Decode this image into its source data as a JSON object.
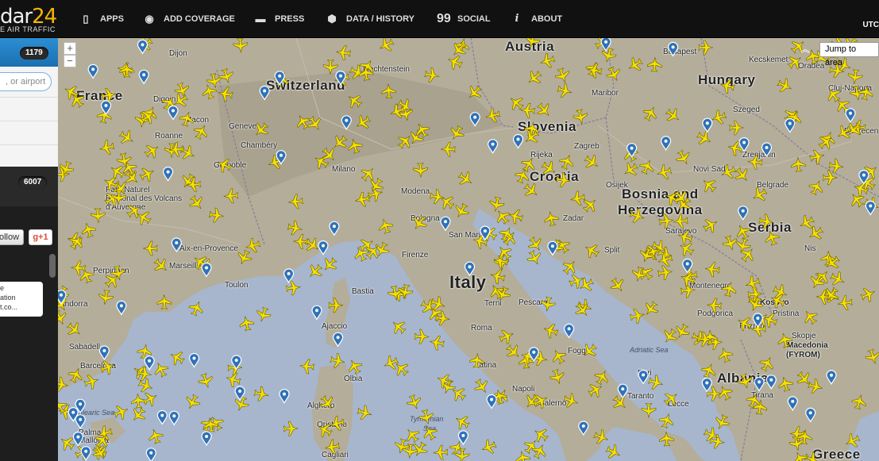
{
  "header": {
    "logo_text": "dar",
    "logo_num": "24",
    "tagline": "E AIR TRAFFIC",
    "utc": "UTC",
    "nav": [
      {
        "label": "APPS",
        "icon": "mobile-icon"
      },
      {
        "label": "ADD COVERAGE",
        "icon": "eye-icon"
      },
      {
        "label": "PRESS",
        "icon": "speech-bubble-icon"
      },
      {
        "label": "DATA / HISTORY",
        "icon": "database-icon"
      },
      {
        "label": "SOCIAL",
        "icon": "quote-icon"
      },
      {
        "label": "ABOUT",
        "icon": "info-icon"
      }
    ]
  },
  "sidebar": {
    "count_top": "1179",
    "search_placeholder": ", or airport",
    "count_total": "6007",
    "follow_label": "ollow",
    "gplus_label": "g+1",
    "box_lines": [
      "e",
      "ation",
      "t.co..."
    ]
  },
  "map": {
    "zoom_in": "+",
    "zoom_out": "−",
    "jump_label": "Jump to area",
    "countries": [
      "France",
      "Switzerland",
      "Austria",
      "Hungary",
      "Slovenia",
      "Croatia",
      "Bosnia and",
      "Herzegovina",
      "Serbia",
      "Italy",
      "Kosovo",
      "Albania",
      "Greece",
      "Liechtenstein"
    ],
    "cities": [
      "Dijon",
      "Budapest",
      "Oradea",
      "Cluj-Napoca",
      "Maribor",
      "Digoin",
      "Macon",
      "Roanne",
      "Geneve",
      "Chambéry",
      "Grenoble",
      "Parc Naturel",
      "Régional des Volcans",
      "d'Auvergne",
      "Aix-en-Provence",
      "Marseille",
      "Toulon",
      "Perpignan",
      "Andorra",
      "Sabadell",
      "Barcelona",
      "Milano",
      "Bologna",
      "San Marino",
      "Modena",
      "Firenze",
      "Rijeka",
      "Zagreb",
      "Zadar",
      "Split",
      "Sarajevo",
      "Novi Sad",
      "Szeged",
      "Belgrade",
      "Zrenjanin",
      "Montenegro",
      "Pristina",
      "Prizren",
      "Skopje",
      "Macedonia",
      "(FYROM)",
      "Foggia",
      "Bari",
      "Taranto",
      "Lecce",
      "Pescara",
      "Terni",
      "Roma",
      "Latina",
      "Napoli",
      "Salerno",
      "Ajaccio",
      "Olbia",
      "Alghero",
      "Oristano",
      "Cagliari",
      "Palma",
      "Mallorca",
      "Tirana",
      "Debrecen",
      "Kecskemet",
      "Osijek",
      "Podgorica",
      "Nis",
      "Bastia"
    ],
    "seas": [
      "Adriatic Sea",
      "Tyrrhenian",
      "Sea",
      "Balearic Sea"
    ],
    "plane_color": "#f5e000",
    "pin_color": "#2f72b8",
    "land_color": "#b3ad9a",
    "water_color": "#a7b6cc"
  }
}
